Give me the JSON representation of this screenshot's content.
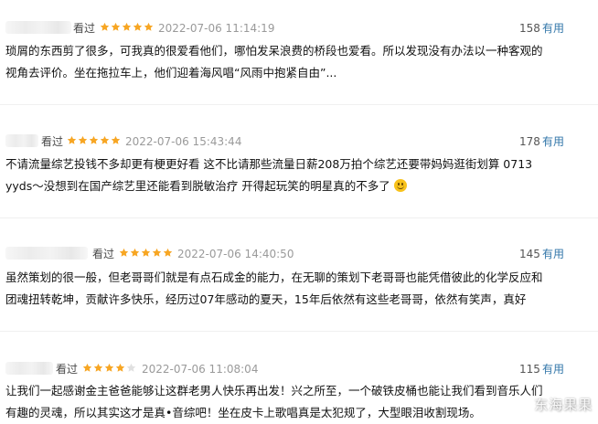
{
  "reviews": [
    {
      "seen": "看过",
      "rating": 5,
      "date": "2022-07-06 11:14:19",
      "votes": "158",
      "useful": "有用",
      "lines": [
        "琐屑的东西剪了很多，可我真的很爱看他们，哪怕发呆浪费的桥段也爱看。所以发现没有办法以一种客观的",
        "视角去评价。坐在拖拉车上，他们迎着海风唱“风雨中抱紧自由”..."
      ]
    },
    {
      "seen": "看过",
      "rating": 5,
      "date": "2022-07-06 15:43:44",
      "votes": "178",
      "useful": "有用",
      "lines": [
        "不请流量综艺投钱不多却更有梗更好看 这不比请那些流量日薪208万拍个综艺还要带妈妈逛街划算 0713",
        "yyds～没想到在国产综艺里还能看到脱敏治疗 开得起玩笑的明星真的不多了"
      ]
    },
    {
      "seen": "看过",
      "rating": 5,
      "date": "2022-07-06 14:40:50",
      "votes": "145",
      "useful": "有用",
      "lines": [
        "虽然策划的很一般，但老哥哥们就是有点石成金的能力，在无聊的策划下老哥哥也能凭借彼此的化学反应和",
        "团魂扭转乾坤，贡献许多快乐，经历过07年感动的夏天，15年后依然有这些老哥哥，依然有笑声，真好"
      ]
    },
    {
      "seen": "看过",
      "rating": 4,
      "date": "2022-07-06 11:08:04",
      "votes": "115",
      "useful": "有用",
      "lines": [
        "让我们一起感谢金主爸爸能够让这群老男人快乐再出发！兴之所至，一个破铁皮桶也能让我们看到音乐人们",
        "有趣的灵魂，所以其实这才是真•音综吧！坐在皮卡上歌唱真是太犯规了，大型眼泪收割现场。"
      ]
    }
  ],
  "icons": {
    "star_full": "star-icon",
    "emoji": "smile-emoji-icon"
  },
  "colors": {
    "star": "#f7a623",
    "star_empty": "#e0e0e0",
    "link": "#3377aa"
  },
  "watermark": "东海果果"
}
